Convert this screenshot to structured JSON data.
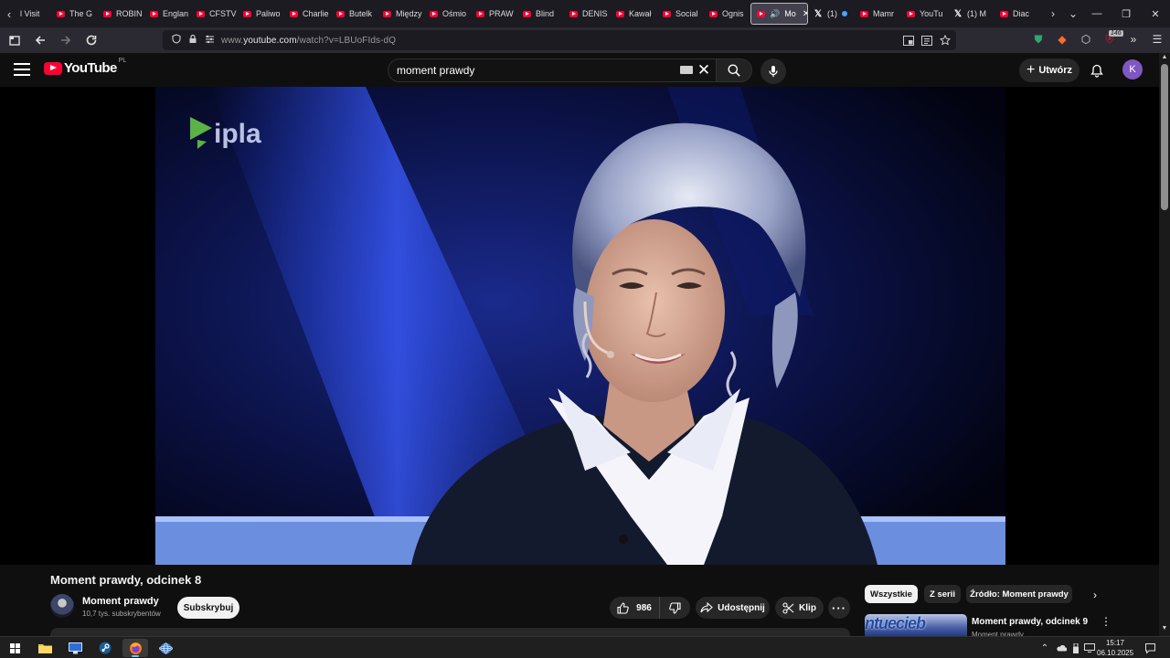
{
  "browser": {
    "tabs": [
      {
        "label": "l Visit",
        "icon": "none"
      },
      {
        "label": "The G",
        "icon": "youtube"
      },
      {
        "label": "ROBIN",
        "icon": "youtube"
      },
      {
        "label": "Englan",
        "icon": "youtube"
      },
      {
        "label": "CFSTV",
        "icon": "youtube"
      },
      {
        "label": "Paliwo",
        "icon": "youtube"
      },
      {
        "label": "Charlie",
        "icon": "youtube"
      },
      {
        "label": "Butelk",
        "icon": "youtube"
      },
      {
        "label": "Między",
        "icon": "youtube"
      },
      {
        "label": "Ośmio",
        "icon": "youtube"
      },
      {
        "label": "PRAW",
        "icon": "youtube"
      },
      {
        "label": "Blind",
        "icon": "youtube"
      },
      {
        "label": "DENIS",
        "icon": "youtube"
      },
      {
        "label": "Kawał",
        "icon": "youtube"
      },
      {
        "label": "Social",
        "icon": "youtube"
      },
      {
        "label": "Ognis",
        "icon": "youtube"
      },
      {
        "label": "Mo",
        "icon": "youtube",
        "active": true
      },
      {
        "label": "(1)",
        "icon": "x"
      },
      {
        "label": "Mamr",
        "icon": "youtube"
      },
      {
        "label": "YouTu",
        "icon": "youtube"
      },
      {
        "label": "(1) M",
        "icon": "x"
      },
      {
        "label": "Diac",
        "icon": "youtube"
      }
    ],
    "url_prefix": "www.",
    "url_domain": "youtube.com",
    "url_path": "/watch?v=LBUoFIds-dQ",
    "extension_badge": "146"
  },
  "youtube": {
    "logo_text": "YouTube",
    "region": "PL",
    "search_value": "moment prawdy",
    "create_label": "Utwórz",
    "avatar_letter": "K"
  },
  "video": {
    "title": "Moment prawdy, odcinek 8",
    "watermark": "ipla",
    "channel_name": "Moment prawdy",
    "channel_subs": "10,7 tys. subskrybentów",
    "subscribe_label": "Subskrybuj",
    "likes": "986",
    "share_label": "Udostępnij",
    "clip_label": "Klip",
    "more_label": "···"
  },
  "sidebar": {
    "chips": [
      "Wszystkie",
      "Z serii",
      "Źródło: Moment prawdy"
    ],
    "recommendation": {
      "title": "Moment prawdy, odcinek 9",
      "channel": "Moment prawdy",
      "thumb_text": "ntuecieb"
    }
  },
  "taskbar": {
    "time": "15:17",
    "date": "06.10.2025"
  }
}
